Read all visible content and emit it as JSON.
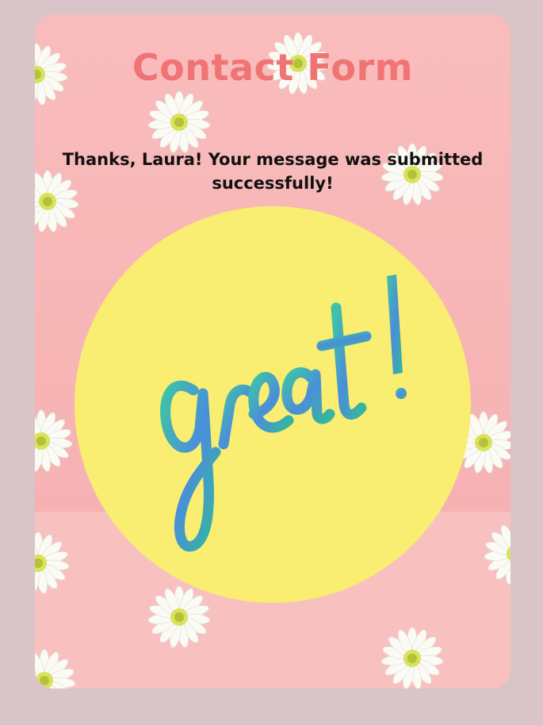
{
  "form": {
    "title": "Contact Form",
    "success_message": "Thanks, Laura! Your message was submitted successfully!",
    "illustration_text": "great!"
  },
  "colors": {
    "page_background": "#d9c4c7",
    "card_background": "#f8b9b9",
    "title_color": "#f07474",
    "circle_color": "#f9ed72",
    "illustration_color": "#3fbfa8"
  },
  "decorations": {
    "background_icon": "daisy-flower-icon"
  }
}
